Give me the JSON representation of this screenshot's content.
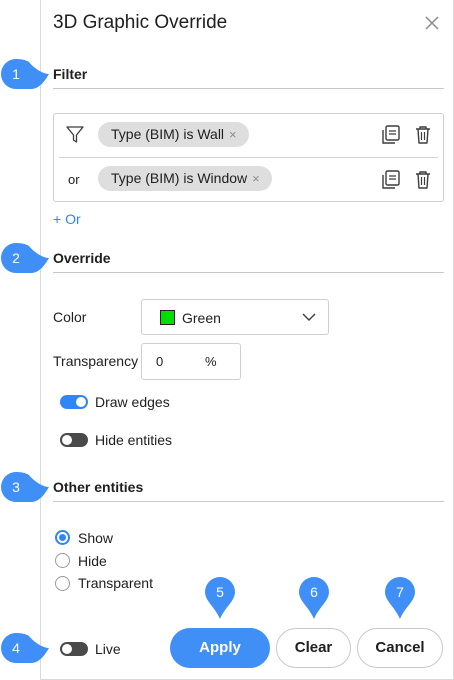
{
  "dialog": {
    "title": "3D Graphic Override",
    "close_icon": "close-icon"
  },
  "callouts": [
    "1",
    "2",
    "3",
    "4",
    "5",
    "6",
    "7"
  ],
  "accent_color": "#2f86f6",
  "filter": {
    "section_title": "Filter",
    "rules": [
      {
        "prefix_icon": "funnel-icon",
        "label": "Type (BIM) is Wall",
        "remove": "×"
      },
      {
        "prefix": "or",
        "label": "Type (BIM) is Window",
        "remove": "×"
      }
    ],
    "add_or": "+ Or"
  },
  "override": {
    "section_title": "Override",
    "color_label": "Color",
    "color_value": "Green",
    "color_swatch": "#00e000",
    "transparency_label": "Transparency",
    "transparency_value": "0",
    "transparency_unit": "%",
    "draw_edges": {
      "label": "Draw edges",
      "on": true
    },
    "hide_entities": {
      "label": "Hide entities",
      "on": false
    }
  },
  "other_entities": {
    "section_title": "Other entities",
    "options": [
      {
        "label": "Show",
        "checked": true
      },
      {
        "label": "Hide",
        "checked": false
      },
      {
        "label": "Transparent",
        "checked": false
      }
    ]
  },
  "footer": {
    "live": {
      "label": "Live",
      "on": false
    },
    "apply": "Apply",
    "clear": "Clear",
    "cancel": "Cancel"
  }
}
